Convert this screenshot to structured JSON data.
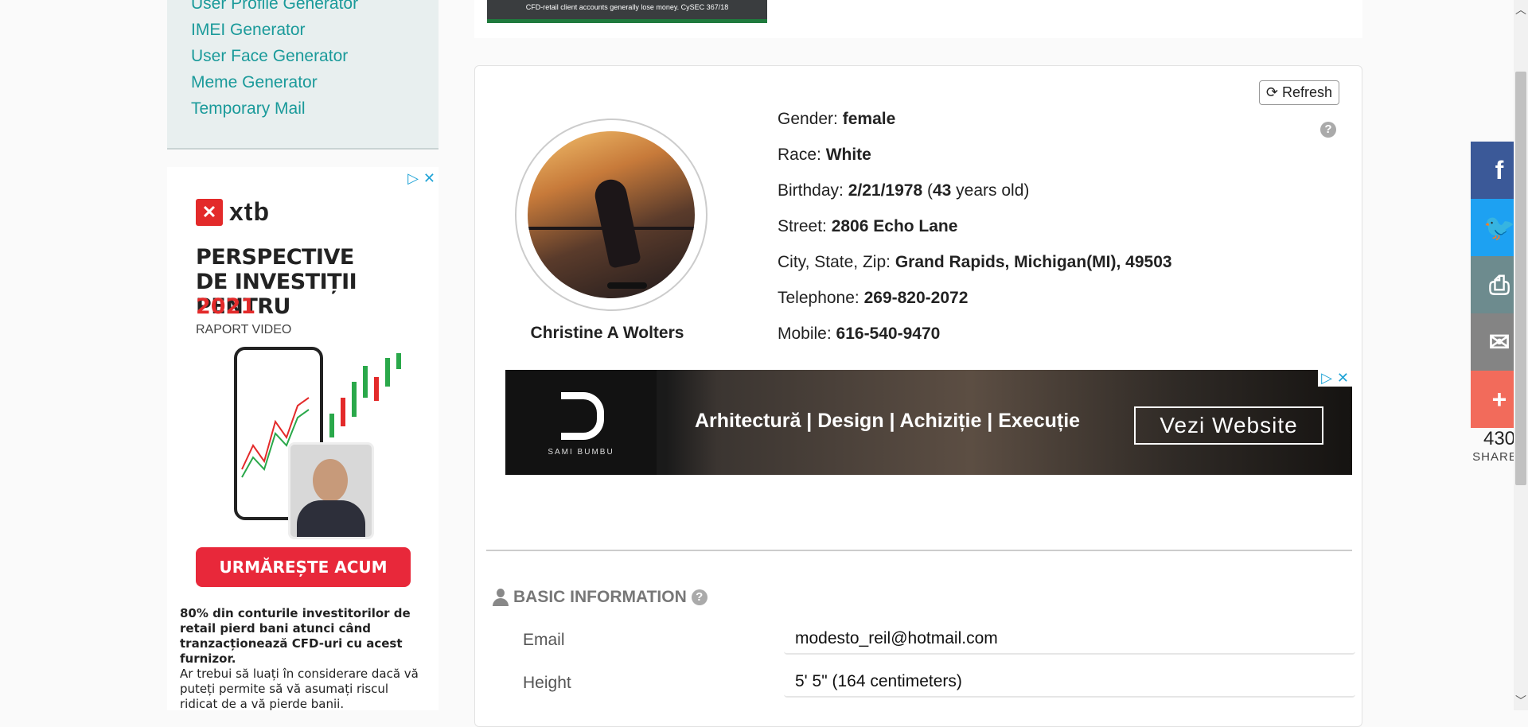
{
  "sidebar": {
    "tools": [
      "User Profile Generator",
      "IMEI Generator",
      "User Face Generator",
      "Meme Generator",
      "Temporary Mail"
    ]
  },
  "side_ad": {
    "brand": "xtb",
    "headline_1": "PERSPECTIVE",
    "headline_2": "DE INVESTIȚII PENTRU",
    "year": "2021",
    "subtitle": "RAPORT VIDEO",
    "cta": "URMĂREȘTE ACUM",
    "disclaimer_bold": "80% din conturile investitorilor de retail pierd bani atunci când tranzacționează CFD-uri cu acest furnizor.",
    "disclaimer": "Ar trebui să luați în considerare dacă vă puteți permite să vă asumați riscul ridicat de a vă pierde banii."
  },
  "top_ad": {
    "text": "CFD-retail client accounts generally lose money. CySEC 367/18"
  },
  "profile": {
    "refresh_label": "Refresh",
    "help": "?",
    "name": "Christine A Wolters",
    "gender_label": "Gender: ",
    "gender": "female",
    "race_label": "Race: ",
    "race": "White",
    "birthday_label": "Birthday: ",
    "birthday": "2/21/1978",
    "age": "43",
    "age_suffix": " years old)",
    "street_label": "Street: ",
    "street": "2806 Echo Lane",
    "city_label": "City, State, Zip: ",
    "city": "Grand Rapids, Michigan(MI), 49503",
    "telephone_label": "Telephone: ",
    "telephone": "269-820-2072",
    "mobile_label": "Mobile: ",
    "mobile": "616-540-9470"
  },
  "banner_ad": {
    "logo_text": "SAMI BUMBU",
    "text": "Arhitectură | Design | Achiziție | Execuție",
    "cta": "Vezi Website"
  },
  "basic_info": {
    "title": "BASIC INFORMATION",
    "rows": [
      {
        "label": "Email",
        "value": "modesto_reil@hotmail.com"
      },
      {
        "label": "Height",
        "value": "5' 5\" (164 centimeters)"
      }
    ]
  },
  "share": {
    "buttons": [
      "f",
      "t",
      "print",
      "mail",
      "+"
    ],
    "colors": [
      "#3b5998",
      "#1da1f2",
      "#6d8b8e",
      "#848484",
      "#f26b5b"
    ],
    "count": "430",
    "count_label": "SHARES"
  }
}
